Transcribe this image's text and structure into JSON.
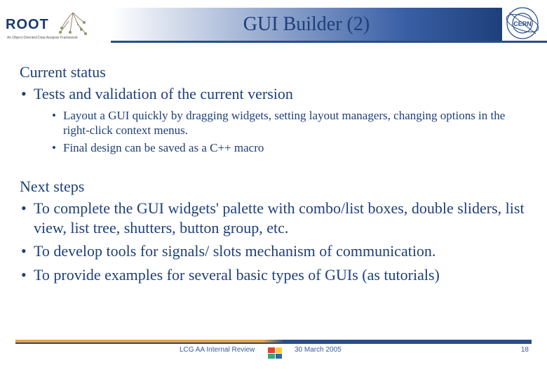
{
  "header": {
    "logo_text": "ROOT",
    "logo_subtitle": "An Object-Oriented Data Analysis Framework",
    "title": "GUI Builder (2)",
    "cern_label": "CERN"
  },
  "content": {
    "section1_head": "Current status",
    "section1_bullets_l1": [
      "Tests and validation of the current version"
    ],
    "section1_bullets_l2": [
      "Layout a GUI quickly by dragging widgets, setting layout managers, changing options in the right-click context menus.",
      "Final design can be saved as a C++ macro"
    ],
    "section2_head": "Next steps",
    "section2_bullets_l1": [
      "To complete the GUI widgets' palette with combo/list boxes, double sliders, list view, list tree, shutters, button group, etc.",
      "To develop tools for signals/ slots mechanism of communication.",
      "To provide examples for several basic types of GUIs (as tutorials)"
    ]
  },
  "footer": {
    "left": "LCG AA Internal Review",
    "date": "30 March 2005",
    "page": "18"
  }
}
